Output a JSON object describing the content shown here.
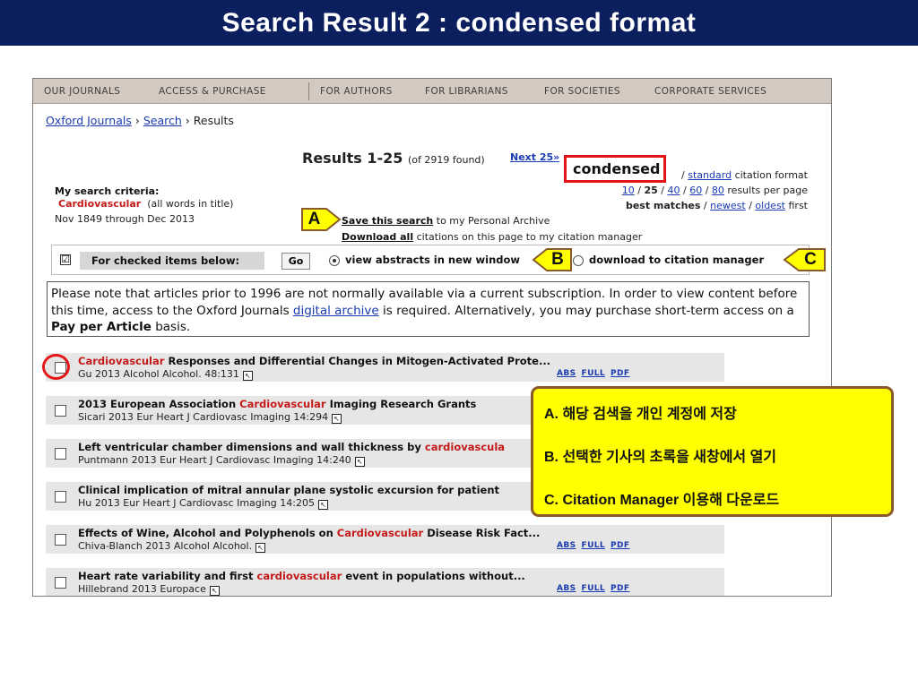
{
  "slide_title": "Search Result 2 : condensed format",
  "nav": {
    "items": [
      "OUR JOURNALS",
      "ACCESS & PURCHASE",
      "FOR AUTHORS",
      "FOR LIBRARIANS",
      "FOR SOCIETIES",
      "CORPORATE SERVICES"
    ]
  },
  "breadcrumb": {
    "home": "Oxford Journals",
    "sep": "›",
    "search": "Search",
    "current": "Results"
  },
  "results": {
    "title": "Results 1-25",
    "found": "(of 2919 found)",
    "next": "Next 25",
    "next_arrow": "»"
  },
  "format": {
    "condensed": "condensed",
    "slash": "/",
    "standard": "standard",
    "suffix": "citation format"
  },
  "per_page": {
    "opt10": "10",
    "opt25": "25",
    "opt40": "40",
    "opt60": "60",
    "opt80": "80",
    "suffix": "results per page"
  },
  "sort": {
    "best": "best matches",
    "newest": "newest",
    "oldest": "oldest",
    "suffix": "first"
  },
  "criteria": {
    "heading": "My search criteria:",
    "term": "Cardiovascular",
    "term_note": "(all words in title)",
    "range": "Nov 1849 through Dec 2013"
  },
  "actions": {
    "save_link": "Save this search",
    "save_rest": "to my Personal Archive",
    "download_link": "Download all",
    "download_rest": "citations on this page to my citation manager"
  },
  "checked_bar": {
    "checkbox": "☑",
    "label": "For checked items below:",
    "go": "Go",
    "option_abstracts": "view abstracts in new window",
    "option_download": "download to citation manager"
  },
  "notice": {
    "part1": "Please note that articles prior to 1996 are not normally available via a current subscription. In order to view content before this time, access to the Oxford Journals",
    "link": "digital archive",
    "part2": "is required. Alternatively, you may purchase short-term access on a",
    "bold": "Pay per Article",
    "part3": "basis."
  },
  "articles": [
    {
      "pre": "",
      "hl": "Cardiovascular",
      "post": " Responses and Differential Changes in Mitogen-Activated Prote...",
      "cite": "Gu 2013 Alcohol Alcohol. 48:131",
      "links": [
        "ABS",
        "FULL",
        "PDF"
      ]
    },
    {
      "pre": "2013 European Association ",
      "hl": "Cardiovascular",
      "post": " Imaging Research Grants",
      "cite": "Sicari 2013 Eur Heart J Cardiovasc Imaging 14:294",
      "links": []
    },
    {
      "pre": "Left ventricular chamber dimensions and wall thickness by ",
      "hl": "cardiovascula",
      "post": "",
      "cite": "Puntmann 2013 Eur Heart J Cardiovasc Imaging 14:240",
      "links": []
    },
    {
      "pre": "Clinical implication of mitral annular plane systolic excursion for patient",
      "hl": "",
      "post": "",
      "cite": "Hu 2013 Eur Heart J Cardiovasc Imaging 14:205",
      "links": []
    },
    {
      "pre": "Effects of Wine, Alcohol and Polyphenols on ",
      "hl": "Cardiovascular",
      "post": " Disease Risk Fact...",
      "cite": "Chiva-Blanch 2013 Alcohol Alcohol.",
      "links": [
        "ABS",
        "FULL",
        "PDF"
      ]
    },
    {
      "pre": "Heart rate variability and first ",
      "hl": "cardiovascular",
      "post": " event in populations without...",
      "cite": "Hillebrand 2013 Europace",
      "links": [
        "ABS",
        "FULL",
        "PDF"
      ]
    }
  ],
  "callouts": {
    "a": "A",
    "b": "B",
    "c": "C"
  },
  "legend": {
    "a": "A. 해당 검색을 개인 계정에 저장",
    "b": "B. 선택한 기사의 초록을 새창에서 열기",
    "c": "C. Citation Manager 이용해 다운로드"
  },
  "colors": {
    "title_bg": "#0b1f5e",
    "callout_fill": "#ffff00",
    "highlight_red": "#c41a1a",
    "link_blue": "#1a3bb1",
    "nav_bg": "#d4c9c0"
  }
}
